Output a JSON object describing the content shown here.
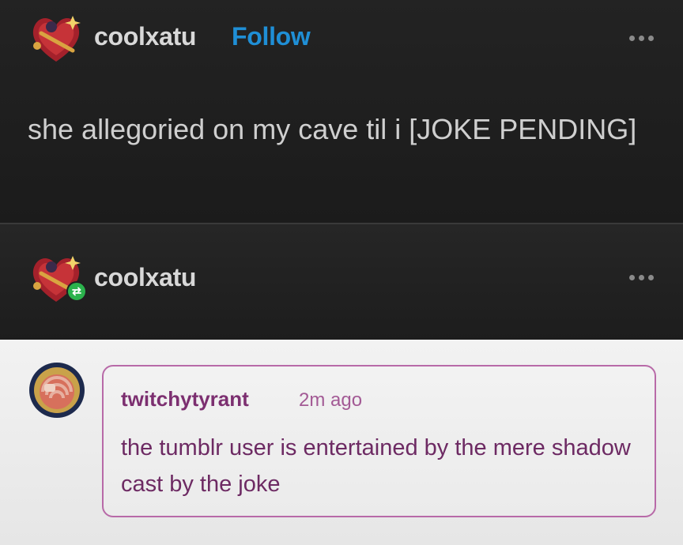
{
  "post": {
    "username": "coolxatu",
    "follow_label": "Follow",
    "more_label": "more-options",
    "text": "she allegoried on my cave til i [JOKE PENDING]"
  },
  "reblog": {
    "username": "coolxatu",
    "badge_icon": "reblog-icon"
  },
  "reply": {
    "username": "twitchytyrant",
    "time": "2m ago",
    "text": "the tumblr user is entertained by the mere shadow cast by the joke"
  },
  "colors": {
    "follow": "#1f8fd6",
    "reply_border": "#b86aa8",
    "reply_text": "#6d2a63",
    "reblog_badge": "#2bb24c"
  }
}
